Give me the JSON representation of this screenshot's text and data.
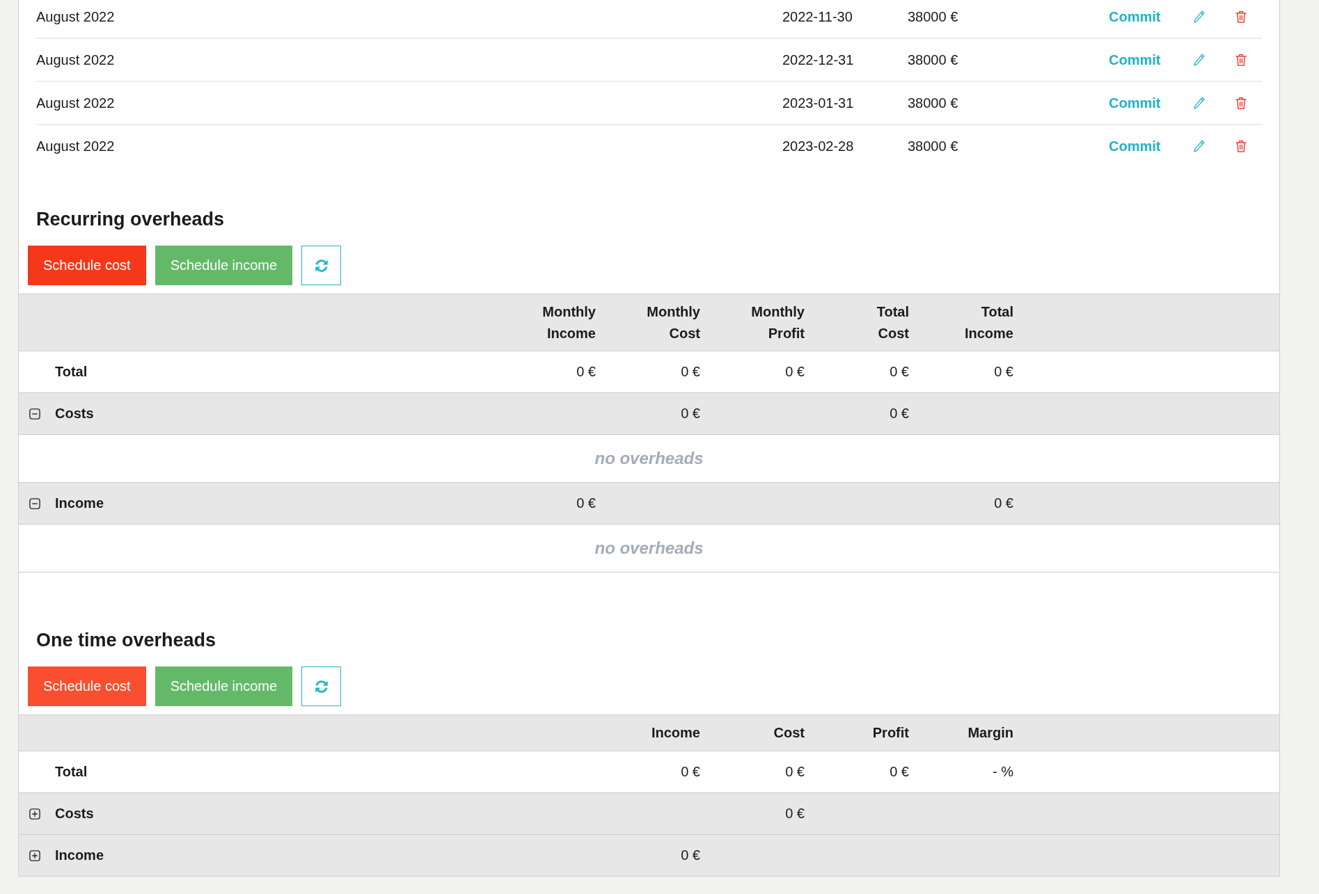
{
  "payments": {
    "rows": [
      {
        "period": "August 2022",
        "date": "2022-11-30",
        "amount": "38000 €",
        "action": "Commit"
      },
      {
        "period": "August 2022",
        "date": "2022-12-31",
        "amount": "38000 €",
        "action": "Commit"
      },
      {
        "period": "August 2022",
        "date": "2023-01-31",
        "amount": "38000 €",
        "action": "Commit"
      },
      {
        "period": "August 2022",
        "date": "2023-02-28",
        "amount": "38000 €",
        "action": "Commit"
      }
    ]
  },
  "recurring_overheads": {
    "title": "Recurring overheads",
    "buttons": [
      {
        "kind": "cost",
        "label": "Schedule cost",
        "hovered": true
      },
      {
        "kind": "income",
        "label": "Schedule income",
        "hovered": false
      },
      {
        "kind": "refresh",
        "hovered": false
      }
    ],
    "table": {
      "columns": [
        "Monthly Income",
        "Monthly Cost",
        "Monthly Profit",
        "Total Cost",
        "Total Income"
      ],
      "rows": [
        {
          "kind": "total",
          "label": "Total",
          "cells": [
            "0 €",
            "0 €",
            "0 €",
            "0 €",
            "0 €"
          ]
        },
        {
          "kind": "group",
          "label": "Costs",
          "expanded": true,
          "cells": [
            null,
            "0 €",
            null,
            "0 €",
            null
          ],
          "empty_text": "no overheads"
        },
        {
          "kind": "group",
          "label": "Income",
          "expanded": true,
          "cells": [
            "0 €",
            null,
            null,
            null,
            "0 €"
          ],
          "empty_text": "no overheads"
        }
      ]
    }
  },
  "one_time_overheads": {
    "title": "One time overheads",
    "buttons": [
      {
        "kind": "cost",
        "label": "Schedule cost",
        "hovered": false
      },
      {
        "kind": "income",
        "label": "Schedule income",
        "hovered": false
      },
      {
        "kind": "refresh",
        "hovered": false
      }
    ],
    "table": {
      "columns": [
        "Income",
        "Cost",
        "Profit",
        "Margin"
      ],
      "rows": [
        {
          "kind": "total",
          "label": "Total",
          "cells": [
            "0 €",
            "0 €",
            "0 €",
            "- %"
          ]
        },
        {
          "kind": "group",
          "label": "Costs",
          "expanded": false,
          "cells": [
            null,
            "0 €",
            null,
            null
          ]
        },
        {
          "kind": "group",
          "label": "Income",
          "expanded": false,
          "cells": [
            "0 €",
            null,
            null,
            null
          ]
        }
      ]
    }
  }
}
